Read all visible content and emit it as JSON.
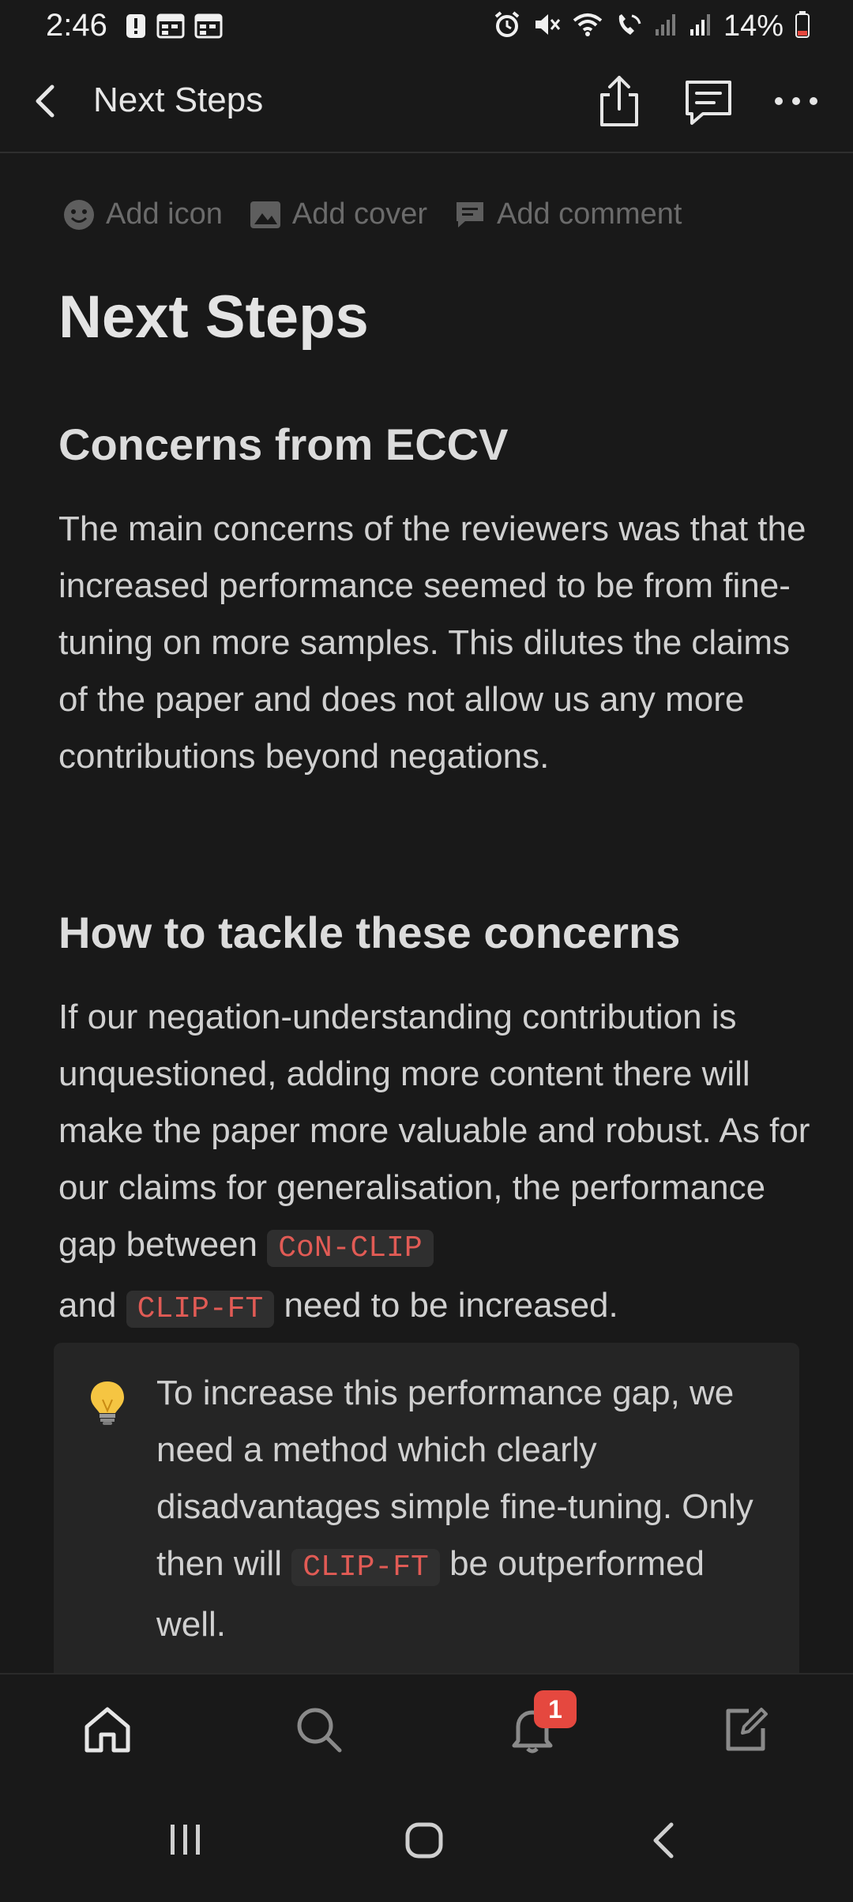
{
  "status_bar": {
    "time": "2:46",
    "battery": "14%",
    "icons": [
      "alert-icon",
      "calendar-icon",
      "calendar-icon",
      "alarm-icon",
      "mute-icon",
      "wifi-icon",
      "wifi-calling-icon",
      "signal-icon",
      "signal-icon",
      "battery-icon"
    ]
  },
  "top_bar": {
    "title": "Next Steps",
    "icons": [
      "back-icon",
      "share-icon",
      "comments-icon",
      "more-icon"
    ]
  },
  "page_actions": {
    "add_icon": "Add icon",
    "add_cover": "Add cover",
    "add_comment": "Add comment"
  },
  "page": {
    "title": "Next Steps",
    "section1": {
      "heading": "Concerns from ECCV",
      "body": "The main concerns of the reviewers was that the increased performance seemed to be from fine-tuning on more samples. This dilutes the claims of the paper and does not allow us any more contributions beyond negations."
    },
    "section2": {
      "heading": "How to tackle these concerns",
      "body_part1": "If our negation-understanding contribution is unquestioned, adding more content there will make the paper more valuable and robust. As for our claims for generalisation, the performance gap between",
      "code1": "CoN-CLIP",
      "body_part2": "and",
      "code2": "CLIP-FT",
      "body_part3": "need to be increased."
    },
    "callout": {
      "icon": "lightbulb-icon",
      "text_part1": "To increase this performance gap, we need a method which clearly disadvantages simple fine-tuning. Only then will",
      "code": "CLIP-FT",
      "text_part2": "be outperformed well."
    }
  },
  "bottom_nav": {
    "items": [
      "home-icon",
      "search-icon",
      "bell-icon",
      "compose-icon"
    ],
    "notification_count": "1"
  },
  "system_nav": [
    "recents-icon",
    "home-circle-icon",
    "back-icon"
  ],
  "colors": {
    "background": "#191919",
    "code_text": "#e15b55",
    "code_bg": "#2f2f2f",
    "callout_bg": "#252525",
    "badge": "#e5483f"
  }
}
